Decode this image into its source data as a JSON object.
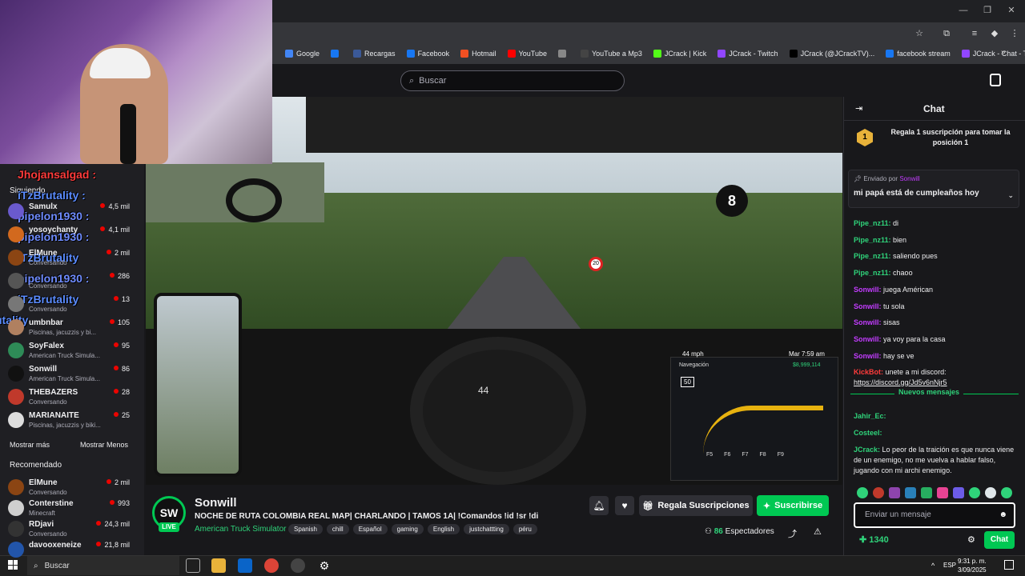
{
  "bookmarks": [
    {
      "label": "Google",
      "color": "#4285f4"
    },
    {
      "label": "",
      "color": "#1877f2"
    },
    {
      "label": "Recargas",
      "color": "#3b5998"
    },
    {
      "label": "Facebook",
      "color": "#1877f2"
    },
    {
      "label": "Hotmail",
      "color": "#f25022"
    },
    {
      "label": "YouTube",
      "color": "#ff0000"
    },
    {
      "label": "",
      "color": "#888888"
    },
    {
      "label": "YouTube a Mp3",
      "color": "#444444"
    },
    {
      "label": "JCrack | Kick",
      "color": "#53fc18"
    },
    {
      "label": "JCrack - Twitch",
      "color": "#9146ff"
    },
    {
      "label": "JCrack (@JCrackTV)...",
      "color": "#000000"
    },
    {
      "label": "facebook stream",
      "color": "#1877f2"
    },
    {
      "label": "JCrack - Chat - Twitch",
      "color": "#9146ff"
    }
  ],
  "search": {
    "placeholder": "Buscar"
  },
  "overlay_names": [
    {
      "text": "Jhojansalgad :",
      "color": "#ff3b3b"
    },
    {
      "text": "iTzBrutality :",
      "color": "#5b8cff"
    },
    {
      "text": "pipelon1930 :",
      "color": "#6f8cff"
    },
    {
      "text": "pipelon1930 :",
      "color": "#6f8cff"
    },
    {
      "text": "iTzBrutality",
      "color": "#5b8cff"
    },
    {
      "text": "pipelon1930 :",
      "color": "#6f8cff"
    },
    {
      "text": "iTzBrutality",
      "color": "#5b8cff"
    },
    {
      "text": "utality",
      "color": "#5b8cff"
    }
  ],
  "sidebar": {
    "following_label": "Siguiendo",
    "following": [
      {
        "name": "Samulx",
        "game": "",
        "viewers": "4,5 mil",
        "avatar": "#6a5acd"
      },
      {
        "name": "yosoychanty",
        "game": "",
        "viewers": "4,1 mil",
        "avatar": "#d2691e"
      },
      {
        "name": "ElMune",
        "game": "Conversando",
        "viewers": "2 mil",
        "avatar": "#8b4513"
      },
      {
        "name": "",
        "game": "Conversando",
        "viewers": "286",
        "avatar": "#555555"
      },
      {
        "name": "",
        "game": "Conversando",
        "viewers": "13",
        "avatar": "#777777"
      },
      {
        "name": "umbnbar",
        "game": "Piscinas, jacuzzis y bi...",
        "viewers": "105",
        "avatar": "#b08060"
      },
      {
        "name": "SoyFalex",
        "game": "American Truck Simula...",
        "viewers": "95",
        "avatar": "#2e8b57"
      },
      {
        "name": "Sonwill",
        "game": "American Truck Simula...",
        "viewers": "86",
        "avatar": "#111111"
      },
      {
        "name": "THEBAZERS",
        "game": "Conversando",
        "viewers": "28",
        "avatar": "#c0392b"
      },
      {
        "name": "MARIANAITE",
        "game": "Piscinas, jacuzzis y biki...",
        "viewers": "25",
        "avatar": "#dddddd"
      }
    ],
    "show_more": "Mostrar más",
    "show_less": "Mostrar Menos",
    "recommended_label": "Recomendado",
    "recommended": [
      {
        "name": "ElMune",
        "game": "Conversando",
        "viewers": "2 mil",
        "avatar": "#8b4513"
      },
      {
        "name": "Conterstine",
        "game": "Minecraft",
        "viewers": "993",
        "avatar": "#cfcfcf"
      },
      {
        "name": "RDjavi",
        "game": "Conversando",
        "viewers": "24,3 mil",
        "avatar": "#333333"
      },
      {
        "name": "davooxeneize",
        "game": "",
        "viewers": "21,8 mil",
        "avatar": "#2255aa"
      }
    ]
  },
  "video": {
    "hud_speed": "44 mph",
    "hud_time": "Mar 7:59 am",
    "hud_money": "$8,999,114",
    "hud_nav": "Navegación",
    "hud_limit": "50",
    "hud_speedo": "44",
    "hud_fkeys": [
      "F5",
      "F6",
      "F7",
      "F8",
      "F9"
    ],
    "sign_limit": "20"
  },
  "stream": {
    "logo": "SW",
    "live": "LIVE",
    "name": "Sonwill",
    "title": "NOCHE DE RUTA COLOMBIA REAL MAP| CHARLANDO  | TAMOS 1A| !Comandos !id !sr !di",
    "game": "American Truck Simulator",
    "tags": [
      "Spanish",
      "chill",
      "Español",
      "gaming",
      "English",
      "justchattting",
      "péru"
    ],
    "gift_label": "Regala Suscripciones",
    "sub_label": "Suscribirse",
    "viewers_count": "86",
    "viewers_label": "Espectadores"
  },
  "chat": {
    "title": "Chat",
    "gift_rank": "1",
    "gift_text": "Regala 1 suscripción para tomar la posición 1",
    "pinned_by_label": "Enviado por",
    "pinned_by_user": "Sonwill",
    "pinned_text": "mi papá está de cumpleaños hoy",
    "messages": [
      {
        "user": "Pipe_nz11:",
        "text": "di",
        "color": "#2fd37a"
      },
      {
        "user": "Pipe_nz11:",
        "text": "bien",
        "color": "#2fd37a"
      },
      {
        "user": "Pipe_nz11:",
        "text": "saliendo pues",
        "color": "#2fd37a"
      },
      {
        "user": "Pipe_nz11:",
        "text": "chaoo",
        "color": "#2fd37a"
      },
      {
        "user": "Sonwill:",
        "text": "juega Américan",
        "color": "#c33cff"
      },
      {
        "user": "Sonwill:",
        "text": "tu sola",
        "color": "#c33cff"
      },
      {
        "user": "Sonwill:",
        "text": "sisas",
        "color": "#c33cff"
      },
      {
        "user": "Sonwill:",
        "text": "ya voy para la casa",
        "color": "#c33cff"
      },
      {
        "user": "Sonwill:",
        "text": "hay se ve",
        "color": "#c33cff"
      },
      {
        "user": "KickBot:",
        "text": "unete a mi discord:",
        "color": "#ff3b3b"
      }
    ],
    "discord_link": "https://discord.gg/Jd5v6nNjr5",
    "new_messages": "Nuevos mensajes",
    "after": [
      {
        "user": "Jahir_Ec:",
        "text": "",
        "color": "#2fd37a"
      },
      {
        "user": "Costeel:",
        "text": "",
        "color": "#2fd37a"
      },
      {
        "user": "JCrack:",
        "text": "Lo peor de la traición es que nunca viene de un enemigo, no me vuelva a hablar falso, jugando con mi archi enemigo.",
        "color": "#2fd37a"
      }
    ],
    "input_placeholder": "Enviar un mensaje",
    "points": "1340",
    "send_label": "Chat"
  },
  "taskbar": {
    "search_placeholder": "Buscar",
    "lang": "ESP",
    "time": "9:31 p. m.",
    "date": "3/09/2025"
  }
}
